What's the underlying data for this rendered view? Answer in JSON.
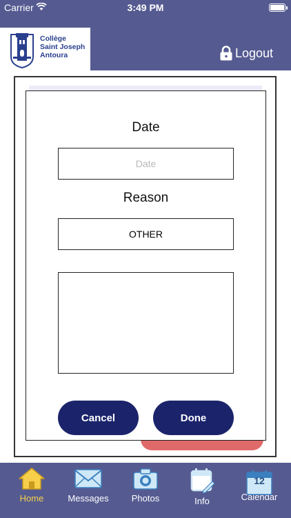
{
  "status_bar": {
    "carrier": "Carrier",
    "time": "3:49 PM"
  },
  "header": {
    "logo_line1": "Collège",
    "logo_line2": "Saint Joseph",
    "logo_line3": "Antoura",
    "logout_label": "Logout"
  },
  "modal": {
    "date_title": "Date",
    "date_placeholder": "Date",
    "reason_title": "Reason",
    "reason_value": "OTHER",
    "notes_value": "",
    "cancel_label": "Cancel",
    "done_label": "Done"
  },
  "tabs": [
    {
      "label": "Home",
      "icon": "home-icon",
      "active": true
    },
    {
      "label": "Messages",
      "icon": "envelope-icon",
      "active": false
    },
    {
      "label": "Photos",
      "icon": "camera-icon",
      "active": false
    },
    {
      "label": "Info",
      "icon": "calendar-edit-icon",
      "active": false
    },
    {
      "label": "Calendar",
      "icon": "calendar-icon",
      "active": false,
      "day": "12"
    }
  ],
  "colors": {
    "header_bg": "#555b91",
    "button_bg": "#1b246b",
    "active_tab": "#f7cf4a",
    "icon_fill": "#cfe8f7"
  }
}
